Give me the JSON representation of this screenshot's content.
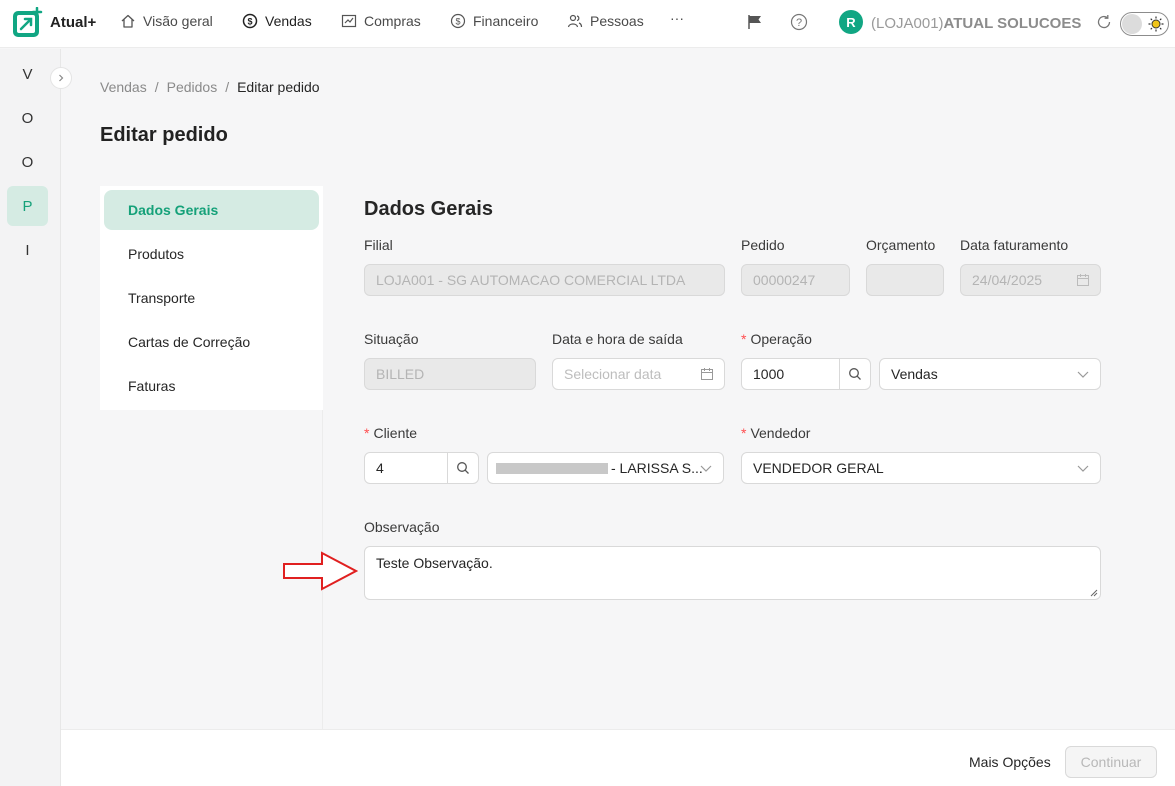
{
  "app": {
    "name": "Atual+"
  },
  "nav": {
    "items": [
      {
        "label": "Visão geral",
        "icon": "home-icon"
      },
      {
        "label": "Vendas",
        "icon": "dollar-circle-icon"
      },
      {
        "label": "Compras",
        "icon": "chart-line-icon"
      },
      {
        "label": "Financeiro",
        "icon": "dollar-circle-icon"
      },
      {
        "label": "Pessoas",
        "icon": "people-icon"
      }
    ],
    "more": "···",
    "active": "Vendas"
  },
  "user": {
    "initial": "R",
    "store_prefix": "(LOJA001)",
    "store_name": "ATUAL SOLUCOES"
  },
  "rail": {
    "items": [
      "V",
      "O",
      "O",
      "P",
      "I"
    ],
    "active_index": 3
  },
  "breadcrumb": {
    "items": [
      "Vendas",
      "Pedidos",
      "Editar pedido"
    ],
    "separator": "/"
  },
  "page": {
    "title": "Editar pedido"
  },
  "menu": {
    "items": [
      "Dados Gerais",
      "Produtos",
      "Transporte",
      "Cartas de Correção",
      "Faturas"
    ],
    "active_index": 0
  },
  "form": {
    "section_title": "Dados Gerais",
    "filial": {
      "label": "Filial",
      "value": "LOJA001 - SG AUTOMACAO COMERCIAL LTDA"
    },
    "pedido": {
      "label": "Pedido",
      "value": "00000247"
    },
    "orcamento": {
      "label": "Orçamento",
      "value": ""
    },
    "data_faturamento": {
      "label": "Data faturamento",
      "value": "24/04/2025"
    },
    "situacao": {
      "label": "Situação",
      "value": "BILLED"
    },
    "data_saida": {
      "label": "Data e hora de saída",
      "placeholder": "Selecionar data"
    },
    "operacao": {
      "label": "Operação",
      "required": "*",
      "code": "1000",
      "value": "Vendas"
    },
    "cliente": {
      "label": "Cliente",
      "required": "*",
      "code": "4",
      "value": "- LARISSA S..."
    },
    "vendedor": {
      "label": "Vendedor",
      "required": "*",
      "value": "VENDEDOR GERAL"
    },
    "observacao": {
      "label": "Observação",
      "value": "Teste Observação."
    }
  },
  "footer": {
    "more_options": "Mais Opções",
    "continue": "Continuar"
  },
  "colors": {
    "accent": "#15a179",
    "accent_bg": "#d5ebe3",
    "required": "#ff4d4f",
    "arrow": "#e02020"
  }
}
